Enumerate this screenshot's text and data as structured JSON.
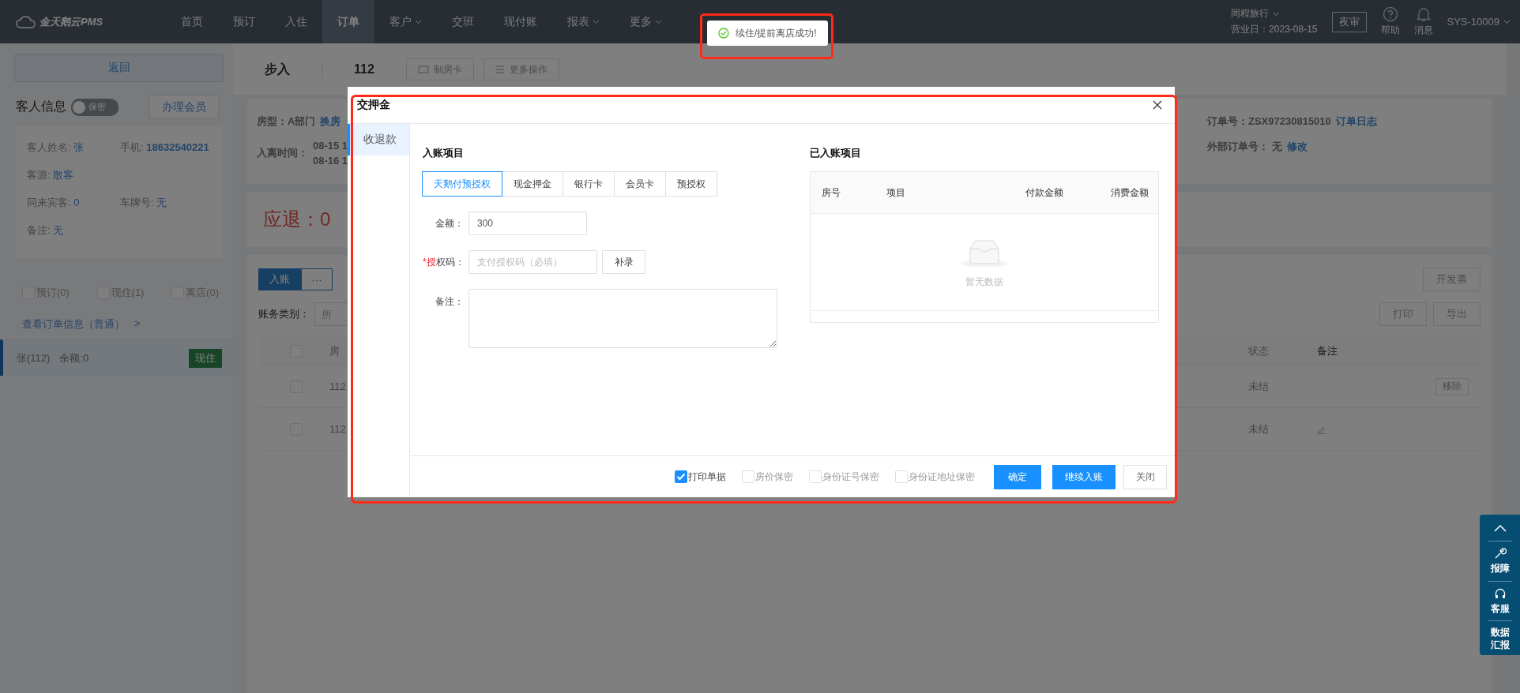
{
  "top_nav": {
    "logo": "金天鹅云PMS",
    "items": [
      {
        "label": "首页",
        "selected": false,
        "dropdown": false
      },
      {
        "label": "预订",
        "selected": false,
        "dropdown": false
      },
      {
        "label": "入住",
        "selected": false,
        "dropdown": false
      },
      {
        "label": "订单",
        "selected": true,
        "dropdown": false
      },
      {
        "label": "客户",
        "selected": false,
        "dropdown": true
      },
      {
        "label": "交班",
        "selected": false,
        "dropdown": false
      },
      {
        "label": "现付账",
        "selected": false,
        "dropdown": false
      },
      {
        "label": "报表",
        "selected": false,
        "dropdown": true
      },
      {
        "label": "更多",
        "selected": false,
        "dropdown": true
      }
    ],
    "hotel": "同程旅行",
    "business_date": "营业日：2023-08-15",
    "night_audit": "夜审",
    "help": "帮助",
    "messages": "消息",
    "user": "SYS-10009"
  },
  "toast": {
    "message": "续住/提前离店成功!",
    "highlighted": true
  },
  "left_panel": {
    "back": "返回",
    "guest_title": "客人信息",
    "privacy_toggle": {
      "label": "保密",
      "on": false
    },
    "member_button": "办理会员",
    "fields": [
      {
        "label": "客人姓名:",
        "value": "张"
      },
      {
        "label": "手机:",
        "value": "18632540221"
      },
      {
        "label": "客源:",
        "value": "散客"
      },
      {
        "label": "同来宾客:",
        "value": "0"
      },
      {
        "label": "车牌号:",
        "value": "无"
      },
      {
        "label": "备注:",
        "value": "无"
      }
    ],
    "filters": [
      {
        "label": "预订(0)",
        "checked": false
      },
      {
        "label": "现住(1)",
        "checked": false
      },
      {
        "label": "离店(0)",
        "checked": false
      }
    ],
    "order_link": "查看订单信息（普通）",
    "order_link_arrow": ">",
    "guests": [
      {
        "name": "张(112)",
        "balance": "余额:0",
        "status": "现住",
        "selected": true
      }
    ]
  },
  "main": {
    "title": "步入",
    "room": "112",
    "buttons": [
      {
        "kind": "card",
        "label": "制房卡"
      },
      {
        "kind": "list",
        "label": "更多操作"
      }
    ],
    "room_type_label": "房型：",
    "room_type": "A部门",
    "change_room": "换房",
    "stay_label": "入离时间：",
    "stay_times": [
      "08-15 1",
      "08-16 1"
    ],
    "order_no_label": "订单号：",
    "order_no": "ZSX97230815010",
    "order_log": "订单日志",
    "ext_label": "外部订单号：",
    "ext_value": "无",
    "ext_edit": "修改",
    "refund_label": "应退：",
    "refund_amount": "0",
    "post_button": "入账",
    "post_more": "···",
    "invoice": "开发票",
    "filter_label": "账务类别：",
    "filter_value": "所",
    "print": "打印",
    "export": "导出",
    "select_all": false,
    "columns": [
      "房",
      "状态",
      "备注"
    ],
    "rows": [
      {
        "checked": false,
        "room": "112",
        "status": "未结",
        "kind": "remove",
        "action": "移除"
      },
      {
        "checked": false,
        "room": "112",
        "status": "未结",
        "kind": "edit"
      }
    ]
  },
  "modal": {
    "title": "交押金",
    "highlighted": true,
    "side_tabs": [
      {
        "label": "收退款",
        "selected": true
      }
    ],
    "entry_title": "入账项目",
    "pay_tabs": [
      {
        "label": "天鹅付预授权",
        "selected": true
      },
      {
        "label": "现金押金",
        "selected": false
      },
      {
        "label": "银行卡",
        "selected": false
      },
      {
        "label": "会员卡",
        "selected": false
      },
      {
        "label": "预授权",
        "selected": false
      }
    ],
    "amount_label": "金额：",
    "amount_value": "300",
    "auth_label": "*授权码：",
    "auth_placeholder": "支付授权码（必填）",
    "supplement": "补录",
    "note_label": "备注：",
    "posted_title": "已入账项目",
    "posted_columns": [
      "房号",
      "项目",
      "付款金额",
      "消费金额"
    ],
    "empty_text": "暂无数据",
    "options": [
      {
        "label": "打印单据",
        "checked": true
      },
      {
        "label": "房价保密",
        "checked": false
      },
      {
        "label": "身份证号保密",
        "checked": false
      },
      {
        "label": "身份证地址保密",
        "checked": false
      }
    ],
    "confirm": "确定",
    "continue": "继续入账",
    "close": "关闭"
  },
  "side_toolbar": {
    "items": [
      {
        "kind": "top"
      },
      {
        "kind": "wrench",
        "label": "报障"
      },
      {
        "kind": "headset",
        "label": "客服"
      },
      {
        "kind": "data",
        "label": "数据汇报"
      }
    ]
  }
}
